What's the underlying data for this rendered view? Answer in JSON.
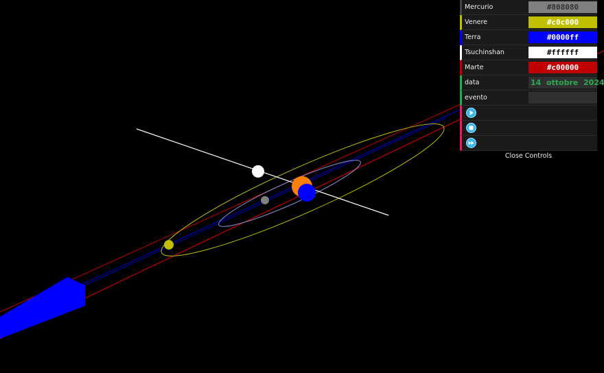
{
  "controls": {
    "rows": [
      {
        "label": "Mercurio",
        "value": "#808080",
        "color": "#808080",
        "text_color": "#333333",
        "border": "#444444"
      },
      {
        "label": "Venere",
        "value": "#c0c000",
        "color": "#c0c000",
        "text_color": "#ffffff",
        "border": "#c0c000"
      },
      {
        "label": "Terra",
        "value": "#0000ff",
        "color": "#0000ff",
        "text_color": "#ffffff",
        "border": "#0000ff"
      },
      {
        "label": "Tsuchinshan",
        "value": "#ffffff",
        "color": "#ffffff",
        "text_color": "#000000",
        "border": "#ffffff"
      },
      {
        "label": "Marte",
        "value": "#c00000",
        "color": "#c00000",
        "text_color": "#ffffff",
        "border": "#c00000"
      }
    ],
    "data_label": "data",
    "data_value": "14  ottobre  2024",
    "evento_label": "evento",
    "evento_value": "",
    "buttons": [
      {
        "icon": "play-icon"
      },
      {
        "icon": "stop-icon"
      },
      {
        "icon": "fast-forward-icon"
      }
    ],
    "close_label": "Close Controls"
  },
  "scene": {
    "sun_color": "#ff7f00",
    "mercury_color": "#808080",
    "venus_color": "#c0c000",
    "earth_color": "#0000ff",
    "comet_color": "#ffffff",
    "mars_color": "#c00000",
    "axis_color": "#ffffff"
  }
}
